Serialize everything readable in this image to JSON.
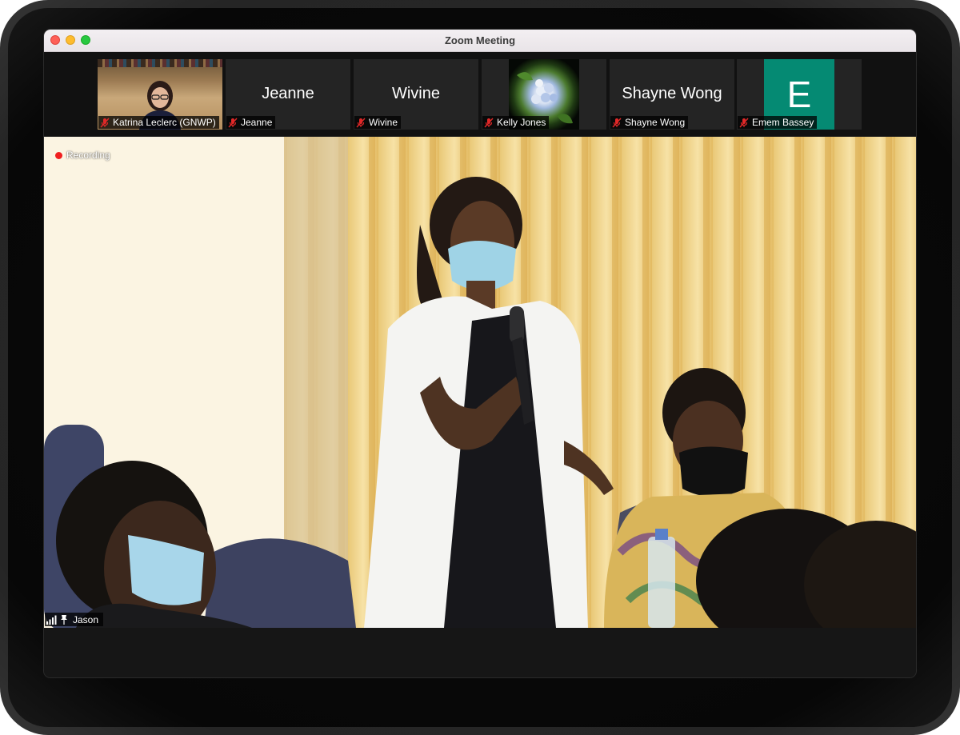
{
  "window": {
    "title": "Zoom Meeting"
  },
  "gallery": {
    "participants": [
      {
        "name": "Katrina Leclerc (GNWP)",
        "display": "",
        "video": "camera"
      },
      {
        "name": "Jeanne",
        "display": "Jeanne",
        "video": "name-only"
      },
      {
        "name": "Wivine",
        "display": "Wivine",
        "video": "name-only"
      },
      {
        "name": "Kelly Jones",
        "display": "",
        "video": "profile-photo"
      },
      {
        "name": "Shayne Wong",
        "display": "Shayne Wong",
        "video": "name-only"
      },
      {
        "name": "Emem Bassey",
        "display": "",
        "avatar_letter": "E",
        "avatar_color": "#058a73",
        "video": "avatar"
      }
    ]
  },
  "main_video": {
    "recording_label": "Recording",
    "speaker_name": "Jason"
  },
  "colors": {
    "mute": "#e02828",
    "recording": "#f01f1f"
  }
}
